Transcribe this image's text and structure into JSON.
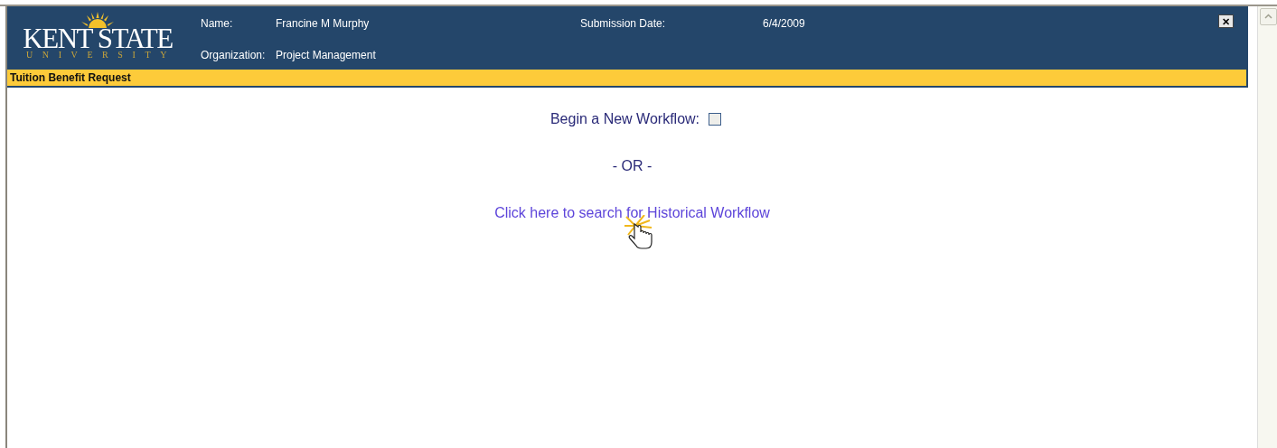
{
  "header": {
    "logo": {
      "wordmark": "KENT STATE",
      "subtitle": "UNIVERSITY"
    },
    "fields": [
      {
        "label": "Name:",
        "value": "Francine M Murphy"
      },
      {
        "label": "Organization:",
        "value": "Project Management"
      }
    ],
    "submission": {
      "label": "Submission Date:",
      "value": "6/4/2009"
    },
    "close": "✕"
  },
  "title_bar": "Tuition Benefit Request",
  "workflow": {
    "label": "Begin a New Workflow:",
    "checked": false
  },
  "separator": "- OR -",
  "link": "Click here to search for Historical Workflow"
}
